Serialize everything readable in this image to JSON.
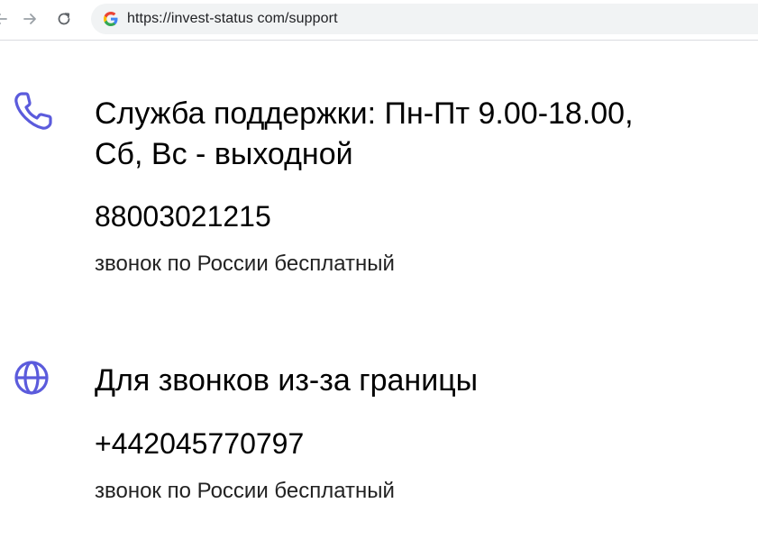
{
  "browser": {
    "url": "https://invest-status com/support",
    "icons": {
      "back": "arrow-left-icon",
      "forward": "arrow-right-icon",
      "reload": "reload-icon",
      "site": "google-g-icon"
    }
  },
  "support": {
    "icon": "phone-icon",
    "heading_line1": "Служба поддержки: Пн-Пт 9.00-18.00,",
    "heading_line2": "Сб, Вс - выходной",
    "phone": "88003021215",
    "note": "звонок по России бесплатный"
  },
  "international": {
    "icon": "globe-icon",
    "heading": "Для звонков из-за границы",
    "phone": "+442045770797",
    "note": "звонок по России бесплатный"
  },
  "colors": {
    "accent": "#5b5bdc",
    "text": "#000000",
    "address_bar_bg": "#f1f3f4"
  }
}
